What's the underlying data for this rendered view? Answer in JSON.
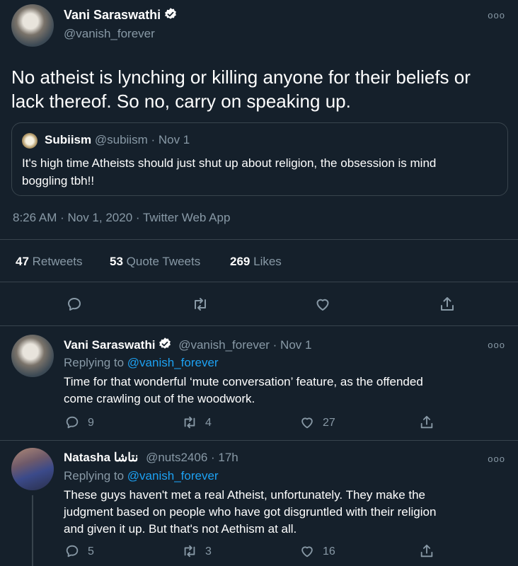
{
  "main_tweet": {
    "author_name": "Vani Saraswathi",
    "handle": "@vanish_forever",
    "more_icon": "more-dots-icon",
    "text_line1": "No atheist is lynching or killing anyone for their beliefs or",
    "text_line2": "lack thereof. So no, carry on speaking up.",
    "quoted": {
      "author_name": "Subiism",
      "handle_date": "@subiism · Nov 1",
      "text_line1": "It's high time Atheists should just shut up about religion, the obsession is mind",
      "text_line2": "boggling tbh!!"
    },
    "timestamp": "8:26 AM · Nov 1, 2020 · Twitter Web App",
    "stats": {
      "retweets_count": "47",
      "retweets_label": "Retweets",
      "quotes_count": "53",
      "quotes_label": "Quote Tweets",
      "likes_count": "269",
      "likes_label": "Likes"
    }
  },
  "replies": [
    {
      "author_name": "Vani Saraswathi",
      "handle_date": "@vanish_forever · Nov 1",
      "replying_prefix": "Replying to",
      "replying_handle": "@vanish_forever",
      "text_line1": "Time for that wonderful ‘mute conversation’ feature, as the offended",
      "text_line2": "come crawling out of the woodwork.",
      "reply_count": "9",
      "retweet_count": "4",
      "like_count": "27"
    },
    {
      "author_name": "Natasha نتاشا",
      "handle_date": "@nuts2406 · 17h",
      "replying_prefix": "Replying to",
      "replying_handle": "@vanish_forever",
      "text_line1": "These guys haven't met a real Atheist, unfortunately. They make the",
      "text_line2": "judgment based on people who have got disgruntled with their religion",
      "text_line3": "and given it up. But that's not Aethism at all.",
      "reply_count": "5",
      "retweet_count": "3",
      "like_count": "16"
    }
  ],
  "colors": {
    "background": "#15202b",
    "muted": "#8899a6",
    "link": "#1da1f2",
    "divider": "#38444d"
  }
}
